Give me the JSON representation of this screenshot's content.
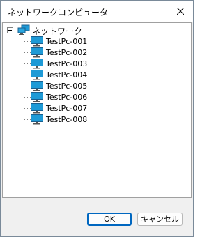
{
  "window": {
    "title": "ネットワークコンピュータ"
  },
  "tree": {
    "root_label": "ネットワーク",
    "items": [
      {
        "label": "TestPc-001"
      },
      {
        "label": "TestPc-002"
      },
      {
        "label": "TestPc-003"
      },
      {
        "label": "TestPc-004"
      },
      {
        "label": "TestPc-005"
      },
      {
        "label": "TestPc-006"
      },
      {
        "label": "TestPc-007"
      },
      {
        "label": "TestPc-008"
      }
    ]
  },
  "buttons": {
    "ok_label": "OK",
    "cancel_label": "キャンセル"
  },
  "colors": {
    "accent": "#0067c0",
    "monitor": "#1e9ad6"
  }
}
